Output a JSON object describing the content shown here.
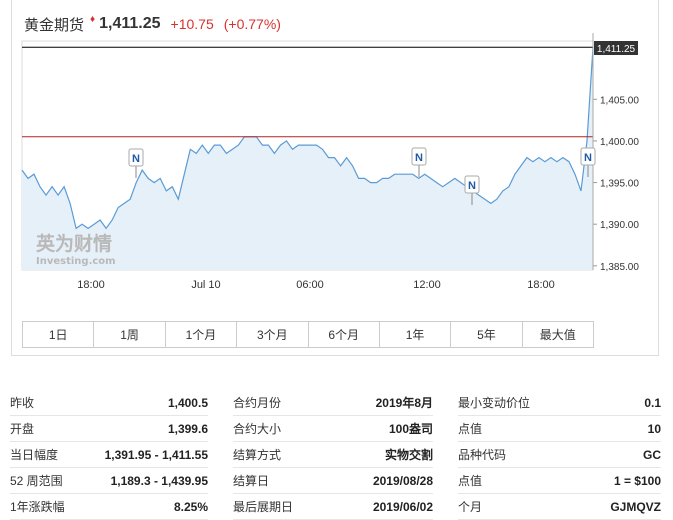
{
  "header": {
    "title": "黄金期货",
    "up_marker": "♦",
    "price": "1,411.25",
    "change": "+10.75",
    "change_pct": "(+0.77%)"
  },
  "colors": {
    "up": "#d9322e",
    "line": "#5b9bd5",
    "area": "#e6f0f8",
    "prev_close": "#b22222"
  },
  "chart_data": {
    "type": "area",
    "current_price_label": "1,411.25",
    "y_ticks": [
      "1,405.00",
      "1,400.00",
      "1,395.00",
      "1,390.00",
      "1,385.00"
    ],
    "x_ticks": [
      "18:00",
      "Jul 10",
      "06:00",
      "12:00",
      "18:00"
    ],
    "ylim": [
      1384.5,
      1412
    ],
    "reference_line": 1400.5,
    "news_markers": [
      "N",
      "N",
      "N",
      "N"
    ],
    "watermark": {
      "brand": "英为财情",
      "sub": "Investing.com"
    },
    "series": [
      {
        "values": [
          1396.5,
          1395.5,
          1396,
          1394.5,
          1393.5,
          1394.5,
          1393.5,
          1394.5,
          1392.5,
          1389.5,
          1390,
          1389.5,
          1390,
          1390.5,
          1389.5,
          1390.5,
          1392,
          1392.5,
          1393,
          1395,
          1396.5,
          1395.5,
          1395,
          1395.5,
          1394,
          1394.5,
          1393,
          1396,
          1399,
          1398.5,
          1399.5,
          1398.5,
          1399.5,
          1399.5,
          1398.5,
          1399,
          1399.5,
          1400.5,
          1400.5,
          1400.5,
          1399.5,
          1399.5,
          1398.5,
          1399.5,
          1400,
          1399,
          1399.5,
          1399.5,
          1399.5,
          1399.5,
          1399,
          1398,
          1398,
          1397,
          1398,
          1397,
          1395.5,
          1395.5,
          1395,
          1395,
          1395.5,
          1395.5,
          1396,
          1396,
          1396,
          1396,
          1395.5,
          1396,
          1395.5,
          1395,
          1394.5,
          1395,
          1395.5,
          1395,
          1394.5,
          1394,
          1393.5,
          1393,
          1392.5,
          1393,
          1394,
          1394.5,
          1396,
          1397,
          1398,
          1397.5,
          1398,
          1397.5,
          1398,
          1397.5,
          1398,
          1397.5,
          1396,
          1394,
          1400,
          1411.25
        ]
      }
    ]
  },
  "tabs": [
    "1日",
    "1周",
    "1个月",
    "3个月",
    "6个月",
    "1年",
    "5年",
    "最大值"
  ],
  "stats": {
    "rows": [
      [
        {
          "label": "昨收",
          "value": "1,400.5"
        },
        {
          "label": "合约月份",
          "value": "2019年8月"
        },
        {
          "label": "最小变动价位",
          "value": "0.1"
        }
      ],
      [
        {
          "label": "开盘",
          "value": "1,399.6"
        },
        {
          "label": "合约大小",
          "value": "100盎司"
        },
        {
          "label": "点值",
          "value": "10"
        }
      ],
      [
        {
          "label": "当日幅度",
          "value": "1,391.95 - 1,411.55"
        },
        {
          "label": "结算方式",
          "value": "实物交割"
        },
        {
          "label": "品种代码",
          "value": "GC"
        }
      ],
      [
        {
          "label": "52 周范围",
          "value": "1,189.3 - 1,439.95"
        },
        {
          "label": "结算日",
          "value": "2019/08/28"
        },
        {
          "label": "点值",
          "value": "1 = $100"
        }
      ],
      [
        {
          "label": "1年涨跌幅",
          "value": "8.25%"
        },
        {
          "label": "最后展期日",
          "value": "2019/06/02"
        },
        {
          "label": "个月",
          "value": "GJMQVZ"
        }
      ]
    ]
  }
}
